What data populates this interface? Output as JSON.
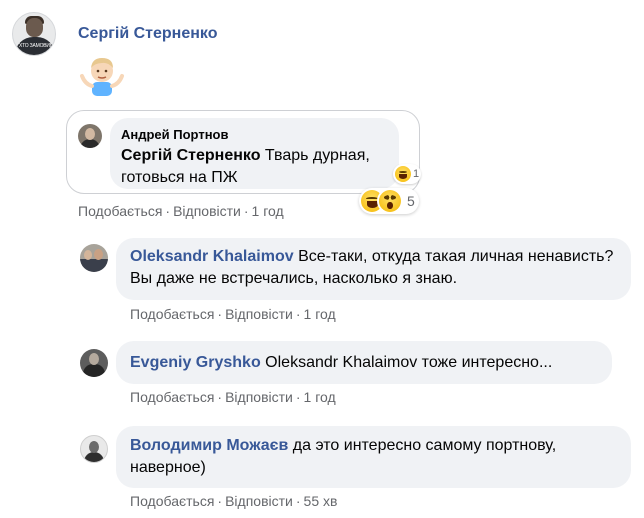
{
  "main_comment": {
    "author": "Сергій Стерненко",
    "avatar_shirt_text": "ХТО ЗАМОВИВ ГАНДЗЮК",
    "sticker": "shrug-emoji",
    "quoted": {
      "author": "Андрей Портнов",
      "tag": "Сергій Стерненко",
      "text": " Тварь дурная, готовься на ПЖ",
      "reaction_icon": "laugh-emoji",
      "reaction_count": "1"
    },
    "reactions": {
      "icons": [
        "laugh-emoji",
        "wow-emoji"
      ],
      "count": "5"
    },
    "actions": {
      "like": "Подобається",
      "reply": "Відповісти",
      "time": "1 год"
    }
  },
  "replies": [
    {
      "author": "Oleksandr Khalaimov",
      "text": " Все-таки, откуда такая личная ненависть? Вы даже не встречались, насколько я знаю.",
      "actions": {
        "like": "Подобається",
        "reply": "Відповісти",
        "time": "1 год"
      }
    },
    {
      "author": "Evgeniy Gryshko",
      "text": " Oleksandr Khalaimov тоже интересно...",
      "actions": {
        "like": "Подобається",
        "reply": "Відповісти",
        "time": "1 год"
      }
    },
    {
      "author": "Володимир Можаєв",
      "text": " да это интересно самому портнову, наверное)",
      "actions": {
        "like": "Подобається",
        "reply": "Відповісти",
        "time": "55 хв"
      }
    }
  ],
  "separator": "·",
  "colors": {
    "name": "#385898",
    "bubble": "#f0f2f5",
    "meta": "#65676b"
  }
}
